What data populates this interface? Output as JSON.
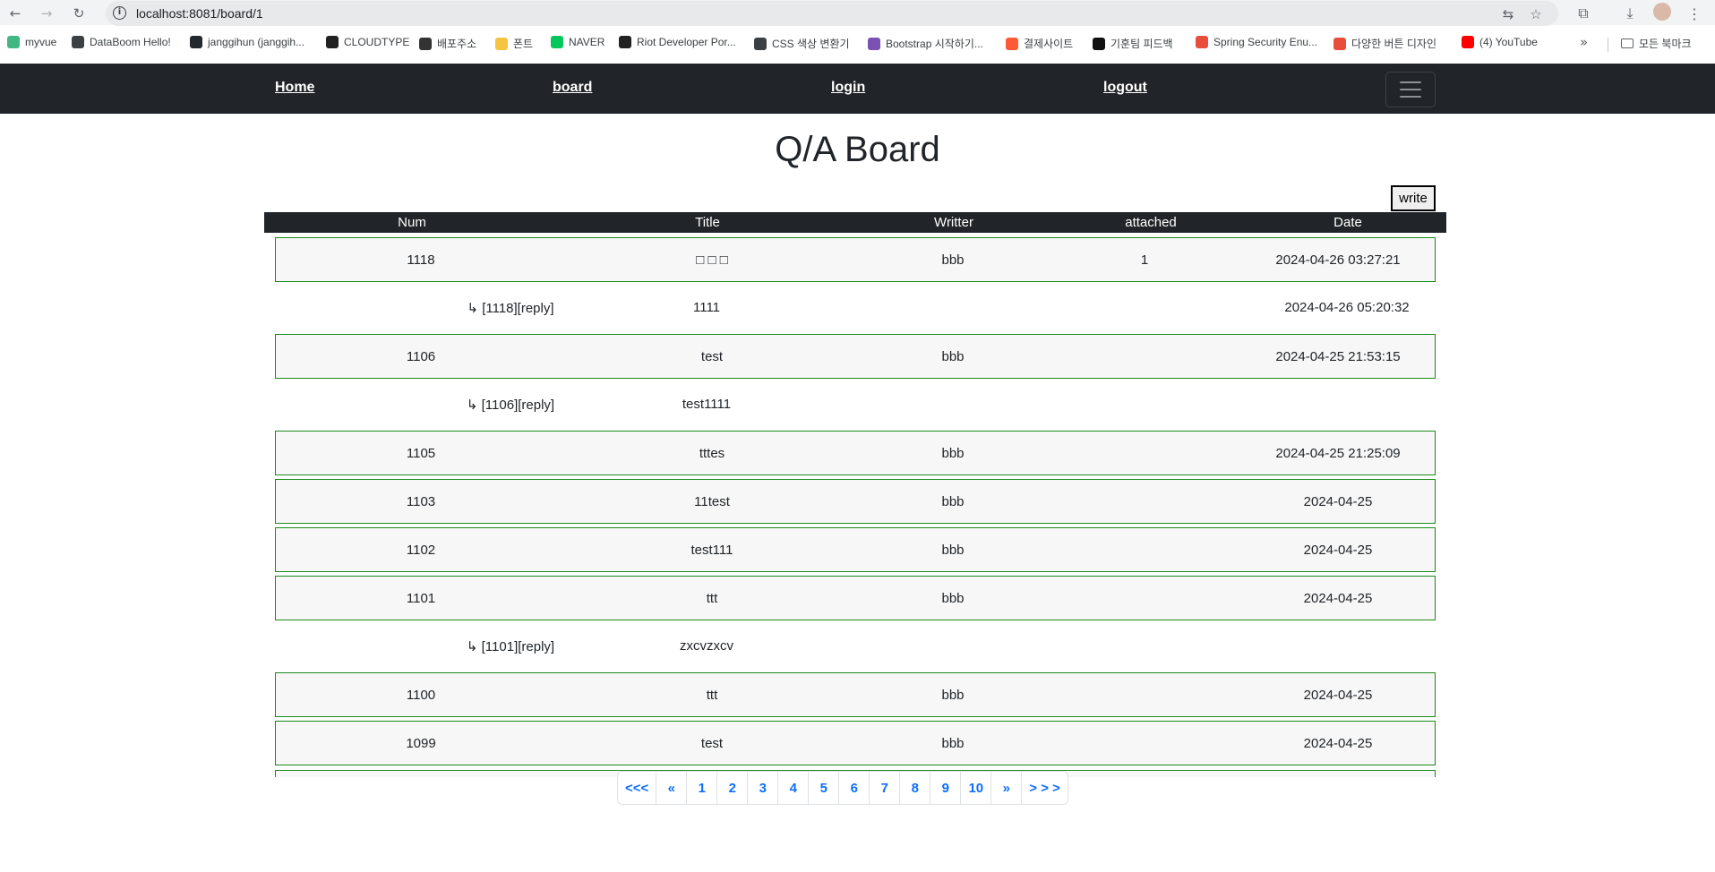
{
  "browser": {
    "url": "localhost:8081/board/1",
    "bookmarks": [
      {
        "label": "myvue",
        "color": "#41b883"
      },
      {
        "label": "DataBoom Hello!",
        "color": "#3c4043"
      },
      {
        "label": "janggihun (janggih...",
        "color": "#24292f"
      },
      {
        "label": "CLOUDTYPE",
        "color": "#222222"
      },
      {
        "label": "배포주소",
        "color": "#333333"
      },
      {
        "label": "폰트",
        "color": "#f5c542"
      },
      {
        "label": "NAVER",
        "color": "#03c75a"
      },
      {
        "label": "Riot Developer Por...",
        "color": "#222222"
      },
      {
        "label": "CSS 색상 변환기",
        "color": "#3c4043"
      },
      {
        "label": "Bootstrap 시작하기...",
        "color": "#7952b3"
      },
      {
        "label": "결제사이트",
        "color": "#ff5a36"
      },
      {
        "label": "기훈팀 피드백",
        "color": "#111111"
      },
      {
        "label": "Spring Security Enu...",
        "color": "#e94e3c"
      },
      {
        "label": "다양한 버튼 디자인",
        "color": "#e94e3c"
      },
      {
        "label": "(4) YouTube",
        "color": "#ff0000"
      }
    ],
    "all_bookmarks_label": "모든 북마크"
  },
  "nav": {
    "home": "Home",
    "board": "board",
    "login": "login",
    "logout": "logout"
  },
  "page": {
    "title": "Q/A Board",
    "write_label": "write"
  },
  "table": {
    "headers": [
      "Num",
      "Title",
      "Writter",
      "attached",
      "Date"
    ],
    "rows": [
      {
        "type": "post",
        "num": "1118",
        "title": "□ □ □",
        "writer": "bbb",
        "attached": "1",
        "date": "2024-04-26 03:27:21"
      },
      {
        "type": "reply",
        "ref": "↳ [1118][reply]",
        "title": "1111",
        "date": "2024-04-26 05:20:32"
      },
      {
        "type": "post",
        "num": "1106",
        "title": "test",
        "writer": "bbb",
        "attached": "",
        "date": "2024-04-25 21:53:15"
      },
      {
        "type": "reply",
        "ref": "↳ [1106][reply]",
        "title": "test1111",
        "date": ""
      },
      {
        "type": "post",
        "num": "1105",
        "title": "tttes",
        "writer": "bbb",
        "attached": "",
        "date": "2024-04-25 21:25:09"
      },
      {
        "type": "post",
        "num": "1103",
        "title": "11test",
        "writer": "bbb",
        "attached": "",
        "date": "2024-04-25"
      },
      {
        "type": "post",
        "num": "1102",
        "title": "test111",
        "writer": "bbb",
        "attached": "",
        "date": "2024-04-25"
      },
      {
        "type": "post",
        "num": "1101",
        "title": "ttt",
        "writer": "bbb",
        "attached": "",
        "date": "2024-04-25"
      },
      {
        "type": "reply",
        "ref": "↳ [1101][reply]",
        "title": "zxcvzxcv",
        "date": ""
      },
      {
        "type": "post",
        "num": "1100",
        "title": "ttt",
        "writer": "bbb",
        "attached": "",
        "date": "2024-04-25"
      },
      {
        "type": "post",
        "num": "1099",
        "title": "test",
        "writer": "bbb",
        "attached": "",
        "date": "2024-04-25"
      }
    ]
  },
  "pagination": [
    "<<<",
    "«",
    "1",
    "2",
    "3",
    "4",
    "5",
    "6",
    "7",
    "8",
    "9",
    "10",
    "»",
    "> > >"
  ],
  "colors": {
    "navbar": "#212529",
    "row_border": "#1a8a1a",
    "link": "#0d6efd"
  }
}
